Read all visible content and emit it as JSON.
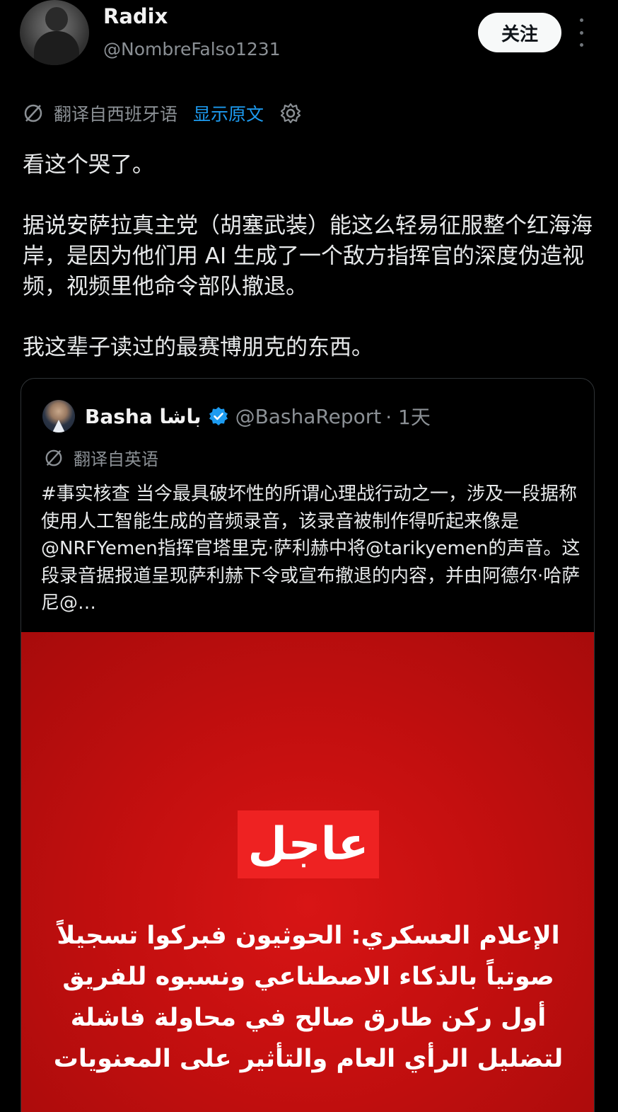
{
  "author": {
    "name": "Radix",
    "handle": "@NombreFalso1231",
    "follow_label": "关注"
  },
  "translation": {
    "label": "翻译自西班牙语",
    "show_original": "显示原文"
  },
  "post": {
    "paragraphs": [
      "看这个哭了。",
      "据说安萨拉真主党（胡塞武装）能这么轻易征服整个红海海岸，是因为他们用 AI 生成了一个敌方指挥官的深度伪造视频，视频里他命令部队撤退。",
      "我这辈子读过的最赛博朋克的东西。"
    ]
  },
  "quoted": {
    "name": "Basha باشا",
    "handle": "@BashaReport",
    "time": "· 1天",
    "translation_label": "翻译自英语",
    "text": "#事实核查 当今最具破坏性的所谓心理战行动之一，涉及一段据称使用人工智能生成的音频录音，该录音被制作得听起来像是@NRFYemen指挥官塔里克·萨利赫中将@tarikyemen的声音。这段录音据报道呈现萨利赫下令或宣布撤退的内容，并由阿德尔·哈萨尼@…",
    "media": {
      "breaking_label": "عاجل",
      "headline": "الإعلام العسكري: الحوثيون فبركوا تسجيلاً صوتياً بالذكاء الاصطناعي ونسبوه للفريق أول ركن طارق صالح في محاولة فاشلة لتضليل الرأي العام والتأثير على المعنويات"
    }
  },
  "colors": {
    "background": "#000000",
    "link": "#1d9bf0",
    "verified": "#1d9bf0",
    "media_red": "#c40f0f"
  },
  "icons": [
    "translate-icon",
    "gear-icon",
    "more-icon",
    "verified-badge-icon"
  ]
}
